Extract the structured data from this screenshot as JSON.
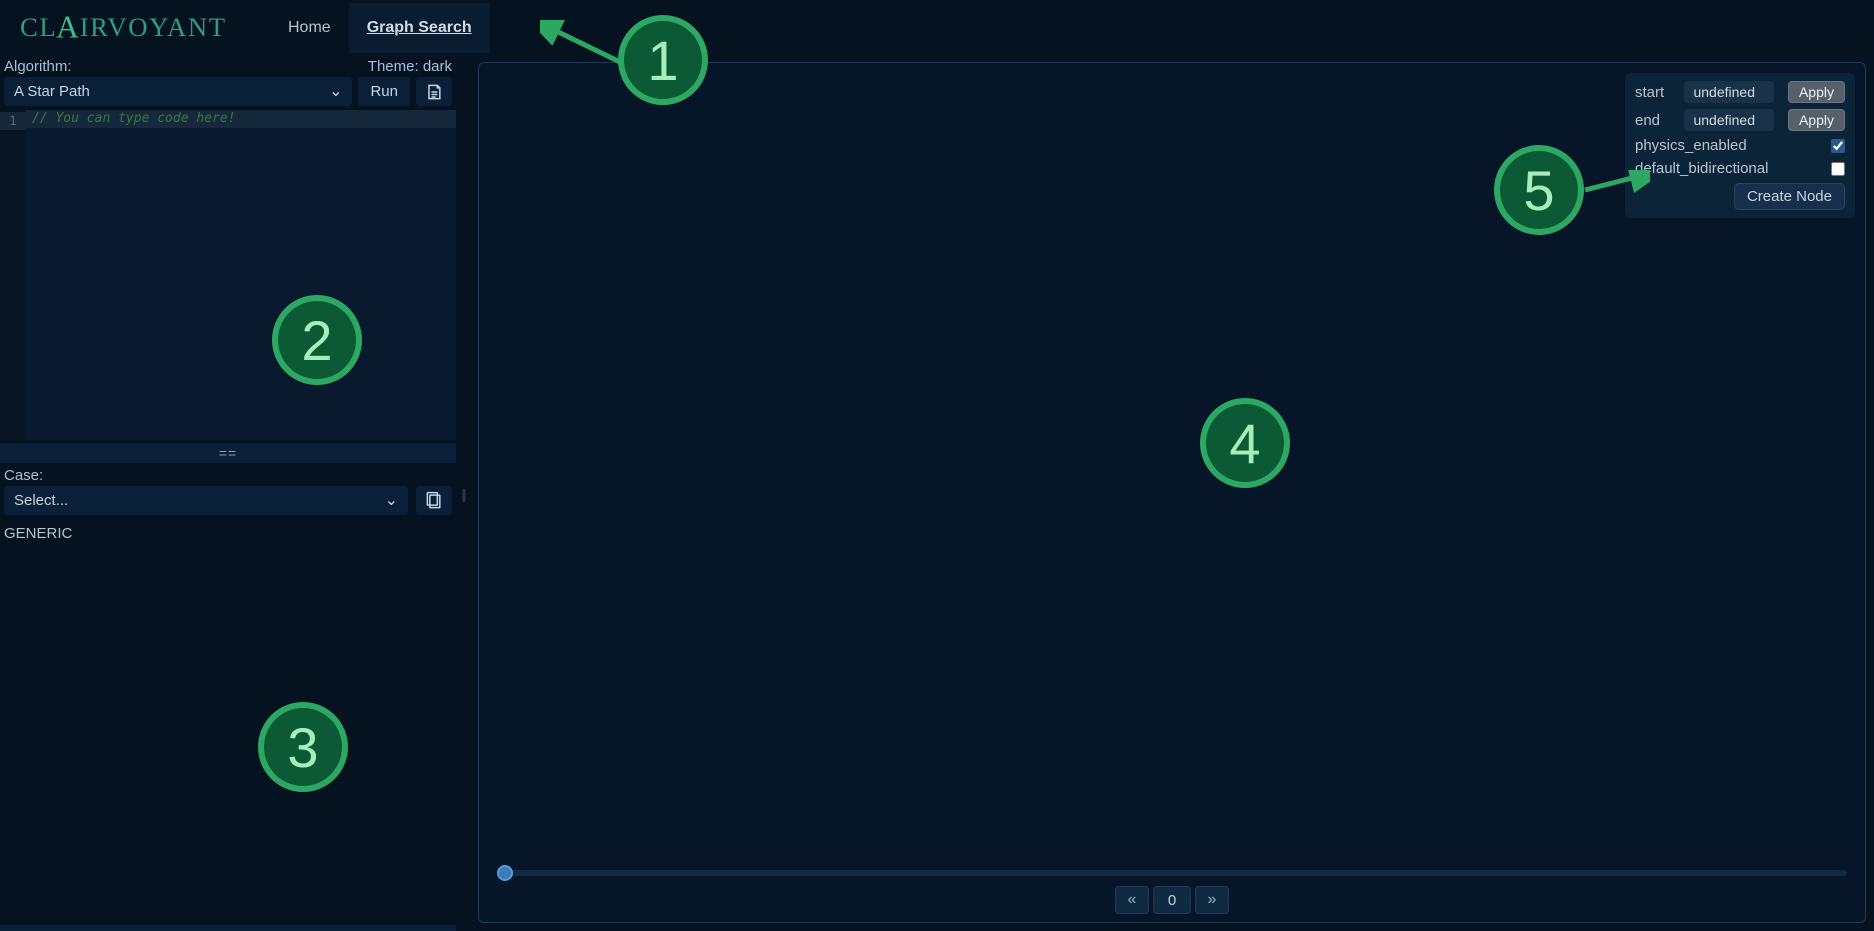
{
  "header": {
    "logo_text": "CLAIRVOYANT",
    "nav": {
      "home": "Home",
      "graph_search": "Graph Search"
    }
  },
  "left": {
    "algorithm_label": "Algorithm:",
    "theme_label": "Theme: dark",
    "algorithm_selected": "A Star Path",
    "run_label": "Run",
    "editor": {
      "line_number": "1",
      "placeholder_comment": "// You can type code here!"
    },
    "separator": "==",
    "case_label": "Case:",
    "case_selected": "Select...",
    "generic_label": "GENERIC"
  },
  "settings": {
    "start_label": "start",
    "start_value": "undefined",
    "start_apply": "Apply",
    "end_label": "end",
    "end_value": "undefined",
    "end_apply": "Apply",
    "physics_label": "physics_enabled",
    "physics_checked": true,
    "bidir_label": "default_bidirectional",
    "bidir_checked": false,
    "create_node": "Create Node"
  },
  "timeline": {
    "prev": "«",
    "step": "0",
    "next": "»"
  },
  "annotations": {
    "1": "1",
    "2": "2",
    "3": "3",
    "4": "4",
    "5": "5"
  }
}
